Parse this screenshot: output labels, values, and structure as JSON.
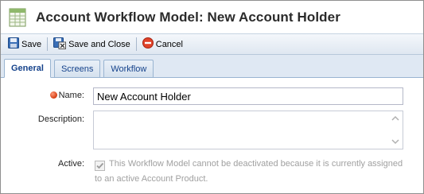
{
  "window": {
    "title": "Account Workflow Model: New Account Holder",
    "icon": "spreadsheet-icon"
  },
  "toolbar": {
    "save_label": "Save",
    "save_close_label": "Save and Close",
    "cancel_label": "Cancel"
  },
  "tabs": [
    {
      "label": "General",
      "active": true
    },
    {
      "label": "Screens",
      "active": false
    },
    {
      "label": "Workflow",
      "active": false
    }
  ],
  "form": {
    "name_label": "Name:",
    "name_value": "New Account Holder",
    "description_label": "Description:",
    "description_value": "",
    "active_label": "Active:",
    "active_checked": true,
    "active_disabled": true,
    "active_note_line1": "This Workflow Model cannot be deactivated because it is currently assigned",
    "active_note_line2": "to an active Account Product."
  },
  "colors": {
    "tab_text": "#15428b",
    "required_dot": "#d43b10",
    "disabled_text": "#a0a0a0"
  }
}
